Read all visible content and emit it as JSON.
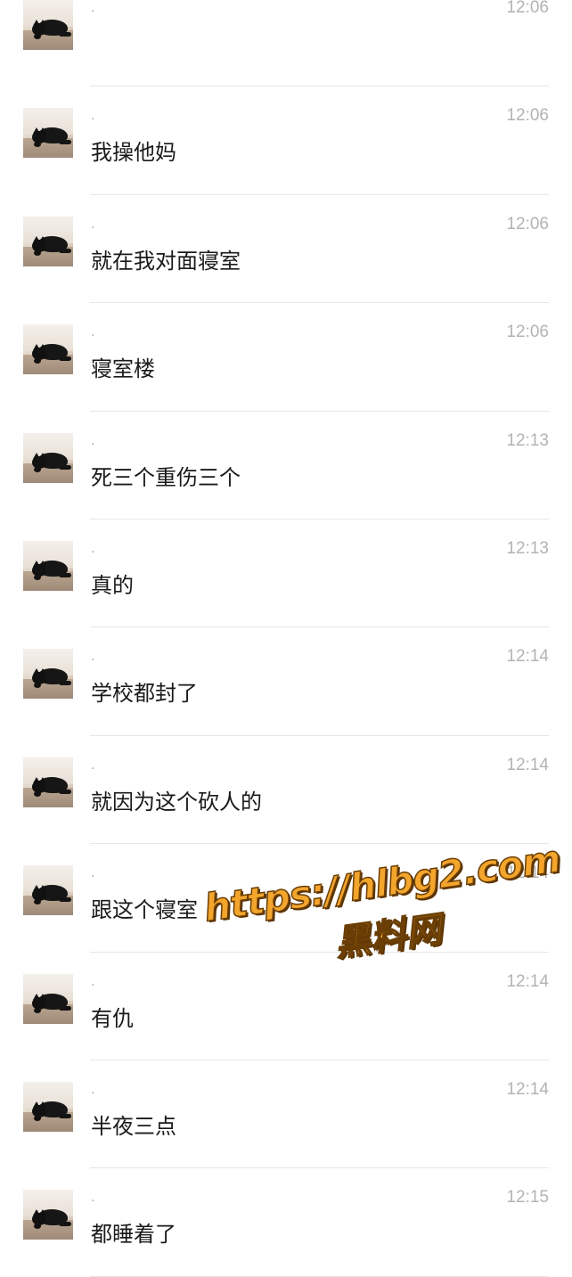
{
  "messages": [
    {
      "sender": ".",
      "time": "12:06",
      "text": ""
    },
    {
      "sender": ".",
      "time": "12:06",
      "text": "我操他妈"
    },
    {
      "sender": ".",
      "time": "12:06",
      "text": "就在我对面寝室"
    },
    {
      "sender": ".",
      "time": "12:06",
      "text": "寝室楼"
    },
    {
      "sender": ".",
      "time": "12:13",
      "text": "死三个重伤三个"
    },
    {
      "sender": ".",
      "time": "12:13",
      "text": "真的"
    },
    {
      "sender": ".",
      "time": "12:14",
      "text": "学校都封了"
    },
    {
      "sender": ".",
      "time": "12:14",
      "text": "就因为这个砍人的"
    },
    {
      "sender": ".",
      "time": "12:14",
      "text": "跟这个寝室"
    },
    {
      "sender": ".",
      "time": "12:14",
      "text": "有仇"
    },
    {
      "sender": ".",
      "time": "12:14",
      "text": "半夜三点"
    },
    {
      "sender": ".",
      "time": "12:15",
      "text": "都睡着了"
    }
  ],
  "watermark": {
    "url": "https://hlbg2.com",
    "name": "黑料网"
  },
  "colors": {
    "background": "#ffffff",
    "text": "#1a1a1a",
    "time": "#b3b3b3",
    "divider": "#e6e6e6",
    "watermark": "#f3a52c"
  },
  "icons": {
    "avatar": "black-cat-photo-avatar"
  }
}
